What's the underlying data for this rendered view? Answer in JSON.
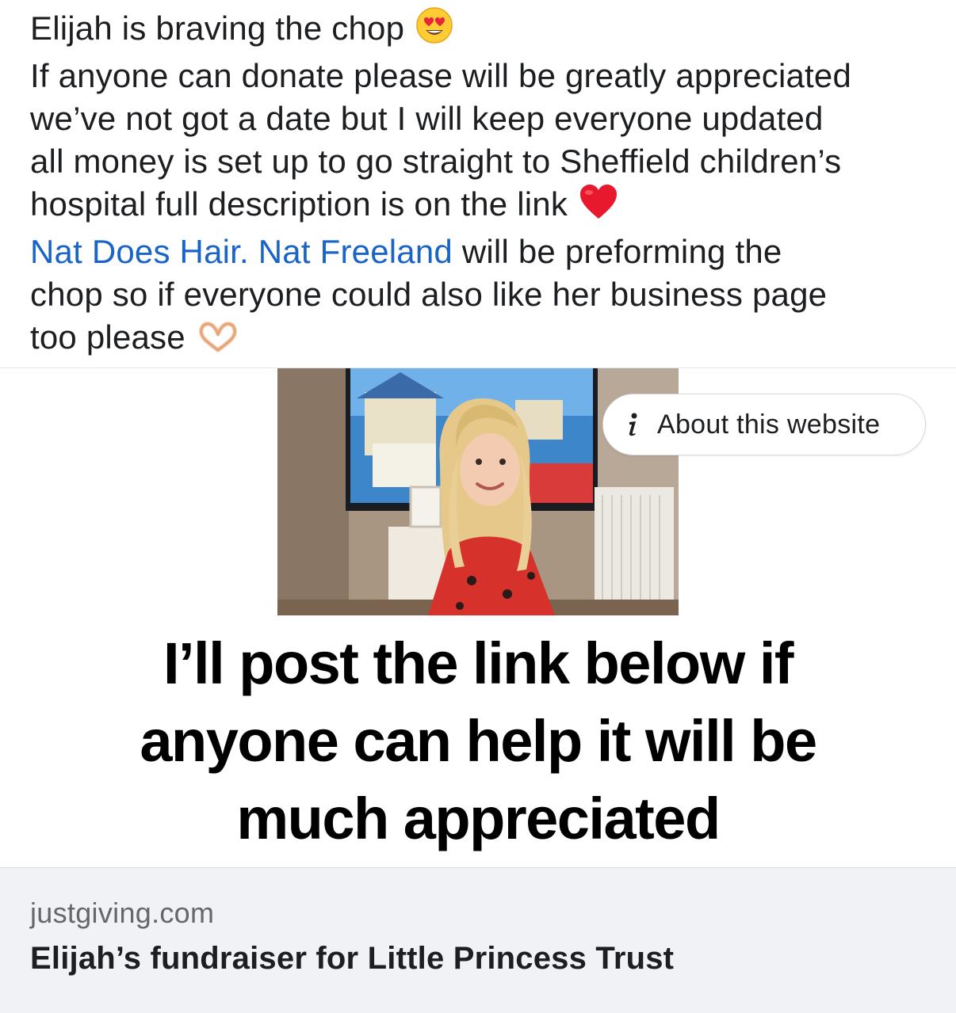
{
  "post": {
    "lines": [
      "Elijah is braving the chop",
      "If anyone can donate please will be greatly appreciated",
      "we’ve not got a date but I will keep everyone updated",
      "all money is set up to go straight to Sheffield children’s",
      "hospital full description is on the link"
    ],
    "mention_1": "Nat Does Hair.",
    "mention_2": "Nat Freeland",
    "after_mentions": " will be preforming the",
    "line_7": "chop so if everyone could also like her business page",
    "line_8": "too please",
    "emojis": {
      "line_1": "heart-eyes-emoji",
      "line_5": "red-heart-emoji",
      "line_8": "heart-hands-emoji"
    }
  },
  "link_preview": {
    "about_label": "About this website",
    "about_icon": "info-icon",
    "caption": "I’ll post the link below if anyone can help it will be much appreciated",
    "domain": "justgiving.com",
    "title": "Elijah’s fundraiser for Little Princess Trust",
    "image": "photo of a smiling child in a red spider-print top in a living room"
  },
  "colors": {
    "mention": "#1a64c8",
    "text": "#1c1e21",
    "meta_background": "#f0f2f5",
    "domain_text": "#65676b"
  }
}
